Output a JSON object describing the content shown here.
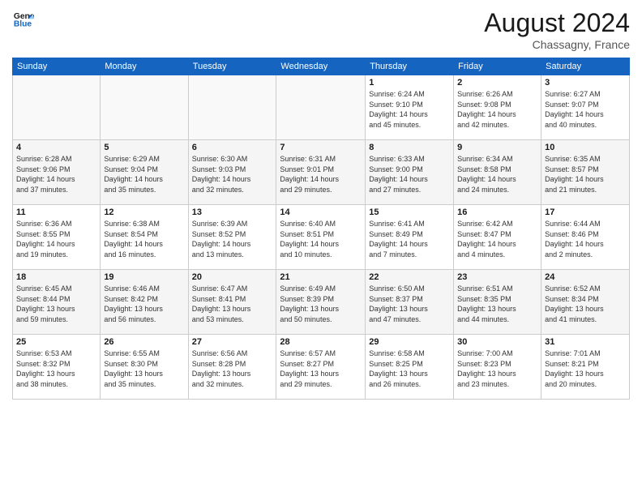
{
  "header": {
    "logo_general": "General",
    "logo_blue": "Blue",
    "month_title": "August 2024",
    "location": "Chassagny, France"
  },
  "columns": [
    "Sunday",
    "Monday",
    "Tuesday",
    "Wednesday",
    "Thursday",
    "Friday",
    "Saturday"
  ],
  "weeks": [
    [
      {
        "day": "",
        "info": ""
      },
      {
        "day": "",
        "info": ""
      },
      {
        "day": "",
        "info": ""
      },
      {
        "day": "",
        "info": ""
      },
      {
        "day": "1",
        "info": "Sunrise: 6:24 AM\nSunset: 9:10 PM\nDaylight: 14 hours\nand 45 minutes."
      },
      {
        "day": "2",
        "info": "Sunrise: 6:26 AM\nSunset: 9:08 PM\nDaylight: 14 hours\nand 42 minutes."
      },
      {
        "day": "3",
        "info": "Sunrise: 6:27 AM\nSunset: 9:07 PM\nDaylight: 14 hours\nand 40 minutes."
      }
    ],
    [
      {
        "day": "4",
        "info": "Sunrise: 6:28 AM\nSunset: 9:06 PM\nDaylight: 14 hours\nand 37 minutes."
      },
      {
        "day": "5",
        "info": "Sunrise: 6:29 AM\nSunset: 9:04 PM\nDaylight: 14 hours\nand 35 minutes."
      },
      {
        "day": "6",
        "info": "Sunrise: 6:30 AM\nSunset: 9:03 PM\nDaylight: 14 hours\nand 32 minutes."
      },
      {
        "day": "7",
        "info": "Sunrise: 6:31 AM\nSunset: 9:01 PM\nDaylight: 14 hours\nand 29 minutes."
      },
      {
        "day": "8",
        "info": "Sunrise: 6:33 AM\nSunset: 9:00 PM\nDaylight: 14 hours\nand 27 minutes."
      },
      {
        "day": "9",
        "info": "Sunrise: 6:34 AM\nSunset: 8:58 PM\nDaylight: 14 hours\nand 24 minutes."
      },
      {
        "day": "10",
        "info": "Sunrise: 6:35 AM\nSunset: 8:57 PM\nDaylight: 14 hours\nand 21 minutes."
      }
    ],
    [
      {
        "day": "11",
        "info": "Sunrise: 6:36 AM\nSunset: 8:55 PM\nDaylight: 14 hours\nand 19 minutes."
      },
      {
        "day": "12",
        "info": "Sunrise: 6:38 AM\nSunset: 8:54 PM\nDaylight: 14 hours\nand 16 minutes."
      },
      {
        "day": "13",
        "info": "Sunrise: 6:39 AM\nSunset: 8:52 PM\nDaylight: 14 hours\nand 13 minutes."
      },
      {
        "day": "14",
        "info": "Sunrise: 6:40 AM\nSunset: 8:51 PM\nDaylight: 14 hours\nand 10 minutes."
      },
      {
        "day": "15",
        "info": "Sunrise: 6:41 AM\nSunset: 8:49 PM\nDaylight: 14 hours\nand 7 minutes."
      },
      {
        "day": "16",
        "info": "Sunrise: 6:42 AM\nSunset: 8:47 PM\nDaylight: 14 hours\nand 4 minutes."
      },
      {
        "day": "17",
        "info": "Sunrise: 6:44 AM\nSunset: 8:46 PM\nDaylight: 14 hours\nand 2 minutes."
      }
    ],
    [
      {
        "day": "18",
        "info": "Sunrise: 6:45 AM\nSunset: 8:44 PM\nDaylight: 13 hours\nand 59 minutes."
      },
      {
        "day": "19",
        "info": "Sunrise: 6:46 AM\nSunset: 8:42 PM\nDaylight: 13 hours\nand 56 minutes."
      },
      {
        "day": "20",
        "info": "Sunrise: 6:47 AM\nSunset: 8:41 PM\nDaylight: 13 hours\nand 53 minutes."
      },
      {
        "day": "21",
        "info": "Sunrise: 6:49 AM\nSunset: 8:39 PM\nDaylight: 13 hours\nand 50 minutes."
      },
      {
        "day": "22",
        "info": "Sunrise: 6:50 AM\nSunset: 8:37 PM\nDaylight: 13 hours\nand 47 minutes."
      },
      {
        "day": "23",
        "info": "Sunrise: 6:51 AM\nSunset: 8:35 PM\nDaylight: 13 hours\nand 44 minutes."
      },
      {
        "day": "24",
        "info": "Sunrise: 6:52 AM\nSunset: 8:34 PM\nDaylight: 13 hours\nand 41 minutes."
      }
    ],
    [
      {
        "day": "25",
        "info": "Sunrise: 6:53 AM\nSunset: 8:32 PM\nDaylight: 13 hours\nand 38 minutes."
      },
      {
        "day": "26",
        "info": "Sunrise: 6:55 AM\nSunset: 8:30 PM\nDaylight: 13 hours\nand 35 minutes."
      },
      {
        "day": "27",
        "info": "Sunrise: 6:56 AM\nSunset: 8:28 PM\nDaylight: 13 hours\nand 32 minutes."
      },
      {
        "day": "28",
        "info": "Sunrise: 6:57 AM\nSunset: 8:27 PM\nDaylight: 13 hours\nand 29 minutes."
      },
      {
        "day": "29",
        "info": "Sunrise: 6:58 AM\nSunset: 8:25 PM\nDaylight: 13 hours\nand 26 minutes."
      },
      {
        "day": "30",
        "info": "Sunrise: 7:00 AM\nSunset: 8:23 PM\nDaylight: 13 hours\nand 23 minutes."
      },
      {
        "day": "31",
        "info": "Sunrise: 7:01 AM\nSunset: 8:21 PM\nDaylight: 13 hours\nand 20 minutes."
      }
    ]
  ]
}
